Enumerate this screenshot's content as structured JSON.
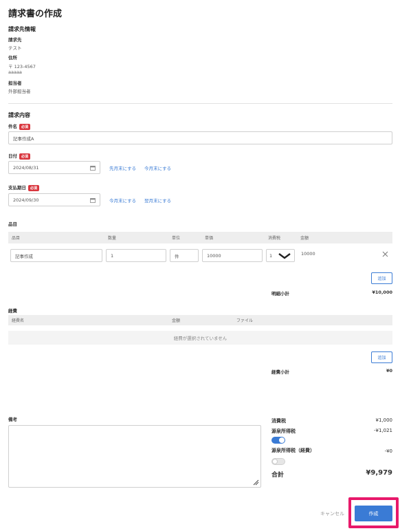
{
  "page": {
    "title": "請求書の作成"
  },
  "billing_info": {
    "heading": "請求先情報",
    "recipient_label": "請求先",
    "recipient_value": "テスト",
    "address_label": "住所",
    "address_line1": "〒 123-4567",
    "address_line2": "aaaaa",
    "person_label": "担当者",
    "person_value": "外部担当者"
  },
  "content": {
    "heading": "請求内容",
    "subject_label": "件名",
    "required_badge": "必須",
    "subject_value": "記事作成A",
    "date_label": "日付",
    "date_value": "2024/08/31",
    "date_links": [
      "先月末にする",
      "今月末にする"
    ],
    "due_label": "支払期日",
    "due_value": "2024/09/30",
    "due_links": [
      "今月末にする",
      "翌月末にする"
    ]
  },
  "items": {
    "heading": "品目",
    "headers": [
      "品目",
      "数量",
      "単位",
      "単価",
      "消費税",
      "金額"
    ],
    "row": {
      "name": "記事作成",
      "quantity": "1",
      "unit": "件",
      "unit_price": "10000",
      "tax": "1",
      "amount": "10000"
    },
    "add_button": "追加",
    "subtotal_label": "明細小計",
    "subtotal_value": "¥10,000"
  },
  "expenses": {
    "heading": "経費",
    "headers": [
      "経費名",
      "金額",
      "ファイル"
    ],
    "empty_text": "経費が選択されていません",
    "add_button": "追加",
    "subtotal_label": "経費小計",
    "subtotal_value": "¥0"
  },
  "notes": {
    "label": "備考",
    "value": ""
  },
  "summary": {
    "tax_label": "消費税",
    "tax_value": "¥1,000",
    "withholding_label": "源泉所得税",
    "withholding_value": "-¥1,021",
    "withholding_toggle_on": true,
    "withholding_exp_label": "源泉所得税（経費）",
    "withholding_exp_value": "-¥0",
    "withholding_exp_toggle_on": false,
    "total_label": "合計",
    "total_value": "¥9,979"
  },
  "footer": {
    "cancel": "キャンセル",
    "create": "作成"
  },
  "colors": {
    "accent": "#3a7bd5",
    "required": "#d9363e",
    "highlight": "#e8196a"
  }
}
